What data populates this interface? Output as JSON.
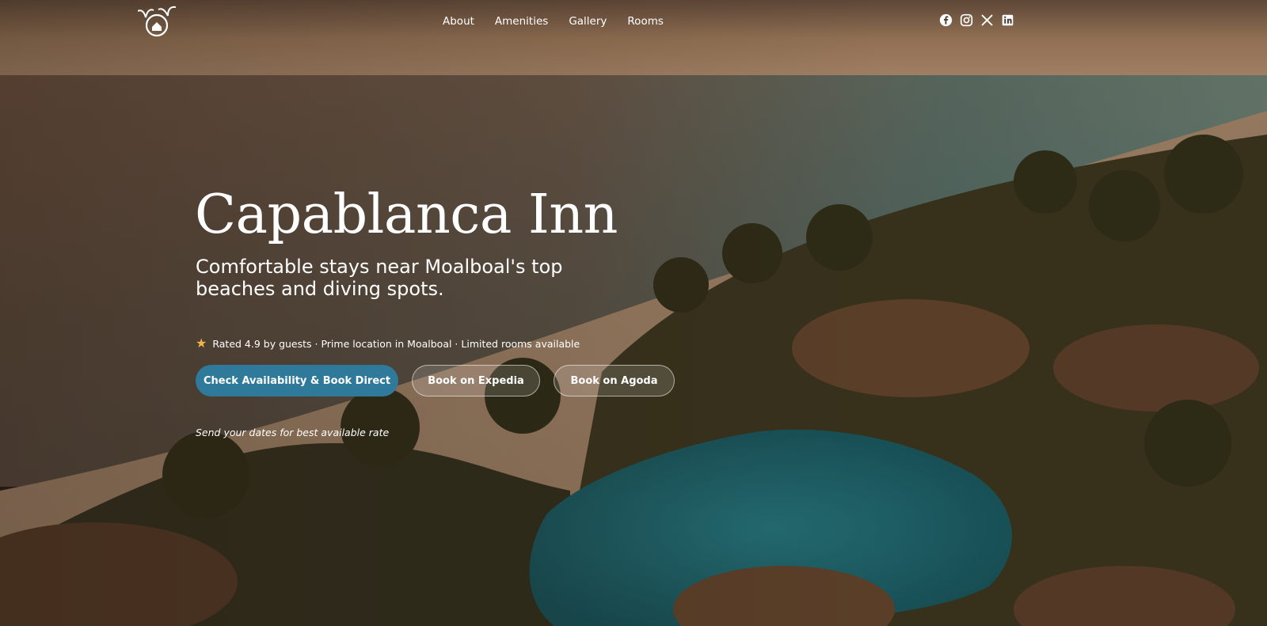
{
  "header": {
    "logo_icon": "palm-house-logo-icon",
    "nav": [
      "About",
      "Amenities",
      "Gallery",
      "Rooms"
    ],
    "social_icons": [
      "facebook-icon",
      "instagram-icon",
      "x-icon",
      "linkedin-icon"
    ]
  },
  "hero": {
    "title": "Capablanca Inn",
    "subtitle": "Comfortable stays near Moalboal's top beaches and diving spots.",
    "rating_icon": "star-icon",
    "rating_text": "Rated 4.9 by guests · Prime location in Moalboal · Limited rooms available",
    "buttons": {
      "primary": "Check Availability & Book Direct",
      "expedia": "Book on Expedia",
      "agoda": "Book on Agoda"
    },
    "note": "Send your dates for best available rate"
  },
  "colors": {
    "accent": "#2f7a9b",
    "star": "#f0b64a",
    "text": "#ffffff"
  }
}
